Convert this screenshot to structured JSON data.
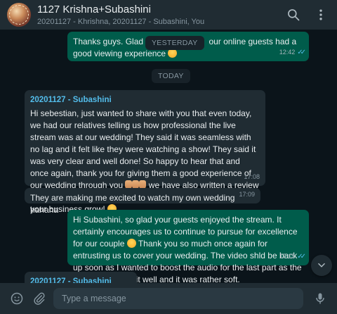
{
  "header": {
    "title": "1127 Krishna+Subashini",
    "subtitle": "20201127 - Khrishna, 20201127 - Subashini, You"
  },
  "messages": [
    {
      "direction": "outgoing",
      "text_before": "Thanks guys. Glad u gu",
      "text_after": "our online guests had a good viewing experience",
      "time": "12:42",
      "status": "read"
    },
    {
      "direction": "incoming",
      "sender": "20201127 - Subashini",
      "text": "Hi sebestian, just wanted to share with you that even today, we had our relatives telling us how professional the live stream was at our wedding! They said it was seamless with no lag and it felt like they were watching a show! They said it was very clear and well done! So happy to hear that and once again, thank you for giving them a good experience of our wedding through you",
      "text_mid": " we have also written a review recommending your services on your fb page ",
      "text_end": ". May your business grow! ",
      "time": "17:08"
    },
    {
      "direction": "incoming",
      "text": "They are making me excited to watch my own wedding hahaha",
      "time": "17:09"
    },
    {
      "direction": "outgoing",
      "text": "Hi Subashini, so glad your guests enjoyed the stream. It certainly encourages us to continue to pursue for excellence for our couple ",
      "text_after": " Thank you so much once again for entrusting us to cover your wedding. The video shld be back up soon as I wanted to boost the audio for the last part as the venue didn't mix it well and it was rather soft.",
      "time": "17:15",
      "status": "read"
    },
    {
      "direction": "incoming",
      "sender": "20201127 - Subashini"
    }
  ],
  "date_chips": {
    "yesterday": "YESTERDAY",
    "today": "TODAY"
  },
  "composer": {
    "placeholder": "Type a message"
  },
  "icons": [
    "search-icon",
    "menu-icon",
    "emoji-icon",
    "attach-icon",
    "mic-icon",
    "chevron-down-icon"
  ],
  "colors": {
    "outgoing_bubble": "#005c4b",
    "incoming_bubble": "#202c33",
    "sender_name": "#53bdeb",
    "background": "#0b141a"
  }
}
